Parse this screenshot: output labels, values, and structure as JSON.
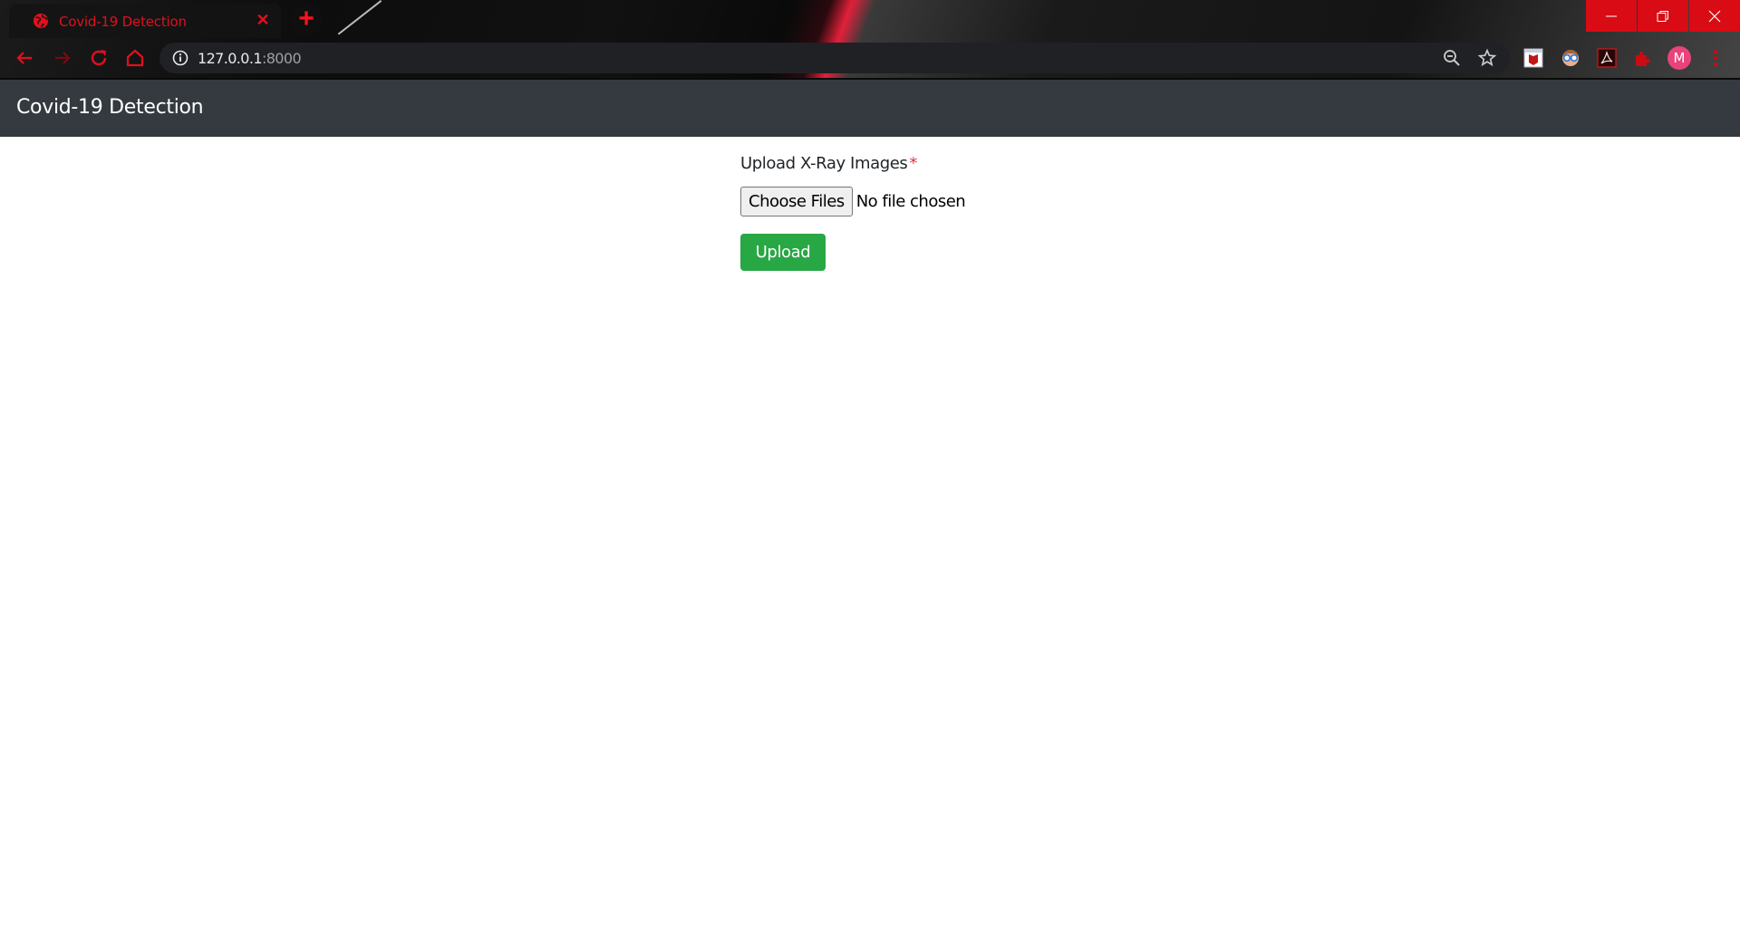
{
  "browser": {
    "tab": {
      "title": "Covid-19 Detection",
      "icon": "globe-icon"
    },
    "new_tab": "+",
    "address": {
      "host": "127.0.0.1",
      "port": ":8000"
    },
    "extensions": [
      "mcafee-icon",
      "face-extension-icon",
      "acrobat-icon",
      "puzzle-extensions-icon"
    ],
    "profile_initial": "M",
    "colors": {
      "accent": "#e0101e",
      "window_controls": "#d90b14",
      "profile": "#e8437a"
    }
  },
  "page": {
    "navbar": {
      "brand": "Covid-19 Detection",
      "background": "#343a40"
    },
    "form": {
      "label": "Upload X-Ray Images",
      "required_marker": "*",
      "file_button": "Choose Files",
      "file_status": "No file chosen",
      "submit_label": "Upload",
      "submit_color": "#28a745"
    }
  }
}
